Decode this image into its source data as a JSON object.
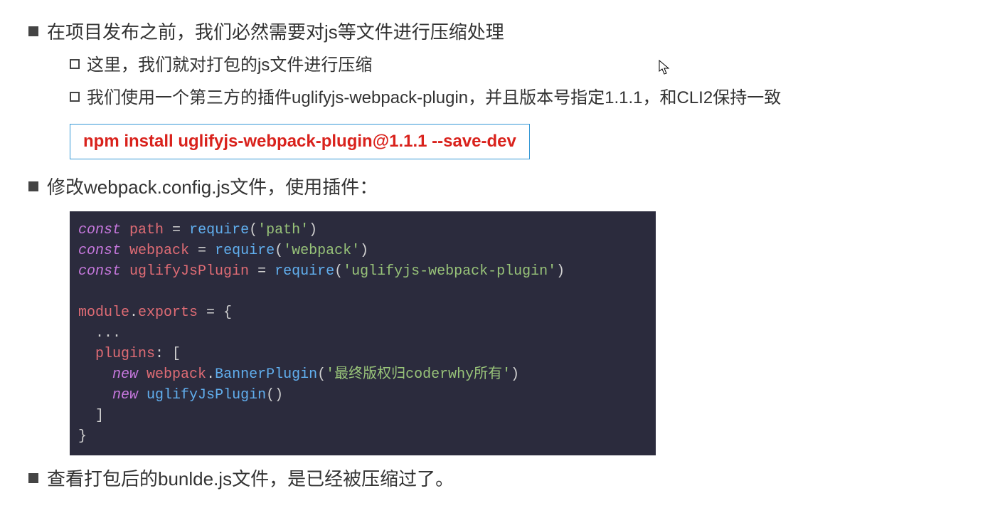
{
  "bullets": {
    "b1": "在项目发布之前，我们必然需要对js等文件进行压缩处理",
    "b1a": "这里，我们就对打包的js文件进行压缩",
    "b1b": "我们使用一个第三方的插件uglifyjs-webpack-plugin，并且版本号指定1.1.1，和CLI2保持一致",
    "b2": "修改webpack.config.js文件，使用插件：",
    "b3": "查看打包后的bunlde.js文件，是已经被压缩过了。"
  },
  "command": "npm install uglifyjs-webpack-plugin@1.1.1 --save-dev",
  "code": {
    "l1": {
      "kw": "const",
      "var": "path",
      "eq": " = ",
      "fn": "require",
      "op": "(",
      "str": "'path'",
      "cp": ")"
    },
    "l2": {
      "kw": "const",
      "var": "webpack",
      "eq": " = ",
      "fn": "require",
      "op": "(",
      "str": "'webpack'",
      "cp": ")"
    },
    "l3": {
      "kw": "const",
      "var": "uglifyJsPlugin",
      "eq": " = ",
      "fn": "require",
      "op": "(",
      "str": "'uglifyjs-webpack-plugin'",
      "cp": ")"
    },
    "l4": {
      "mod": "module",
      "dot": ".",
      "exp": "exports",
      "eq": " = {"
    },
    "l5": "  ...",
    "l6": {
      "prop": "plugins",
      "colon": ": ["
    },
    "l7": {
      "kw": "new",
      "cls": "webpack",
      "dot": ".",
      "m": "BannerPlugin",
      "op": "(",
      "str": "'最终版权归coderwhy所有'",
      "cp": ")"
    },
    "l8": {
      "kw": "new",
      "cls": "uglifyJsPlugin",
      "op": "(",
      "cp": ")"
    },
    "l9": "  ]",
    "l10": "}"
  }
}
